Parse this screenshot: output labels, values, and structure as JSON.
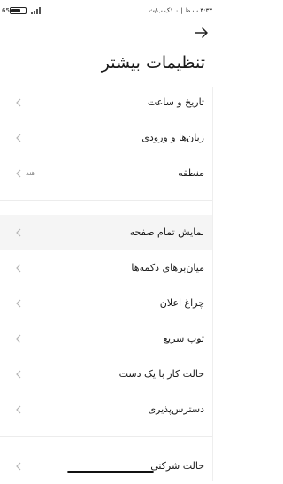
{
  "status_bar": {
    "battery_level": "65",
    "battery_fraction": 0.65,
    "time": "۴:۳۳ ب.ظ | ۱.۰ک.ب/ث"
  },
  "header": {
    "back_icon": "arrow-right-icon",
    "title": "تنظیمات بیشتر"
  },
  "groups": [
    {
      "items": [
        {
          "label": "تاریخ و ساعت",
          "value": ""
        },
        {
          "label": "زبان‌ها و ورودی",
          "value": ""
        },
        {
          "label": "منطقه",
          "value": "هند"
        }
      ]
    },
    {
      "items": [
        {
          "label": "نمایش تمام صفحه",
          "value": ""
        },
        {
          "label": "میان‌برهای دکمه‌ها",
          "value": ""
        },
        {
          "label": "چراغ اعلان",
          "value": ""
        },
        {
          "label": "توپ سریع",
          "value": ""
        },
        {
          "label": "حالت کار با یک دست",
          "value": ""
        },
        {
          "label": "دسترس‌پذیری",
          "value": ""
        }
      ]
    },
    {
      "items": [
        {
          "label": "حالت شرکتی",
          "value": ""
        }
      ]
    }
  ],
  "icons": {
    "chevron": "chevron-left-icon"
  }
}
